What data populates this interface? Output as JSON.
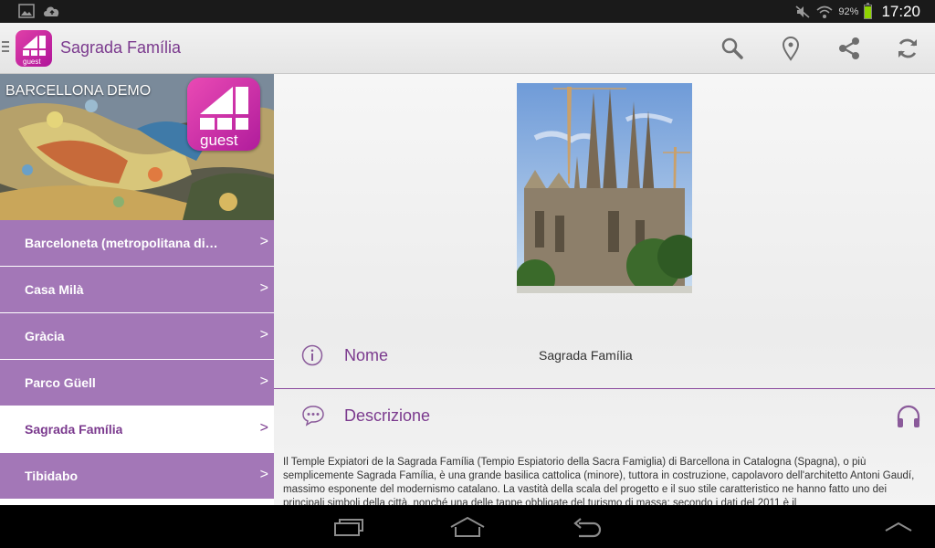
{
  "status_bar": {
    "battery": "92%",
    "time": "17:20",
    "icons": [
      "gallery-icon",
      "cloud-upload-icon",
      "mute-icon",
      "wifi-icon",
      "battery-icon"
    ]
  },
  "action_bar": {
    "title": "Sagrada Família",
    "logo_text": "guest",
    "actions": [
      "search-icon",
      "location-pin-icon",
      "share-icon",
      "refresh-icon"
    ]
  },
  "sidebar": {
    "hero_label": "BARCELLONA DEMO",
    "logo_text": "guest",
    "items": [
      {
        "label": "Barceloneta (metropolitana di…",
        "chevron": ">"
      },
      {
        "label": "Casa Milà",
        "chevron": ">"
      },
      {
        "label": "Gràcia",
        "chevron": ">"
      },
      {
        "label": "Parco Güell",
        "chevron": ">"
      },
      {
        "label": "Sagrada Família",
        "chevron": ">",
        "active": true
      },
      {
        "label": "Tibidabo",
        "chevron": ">"
      }
    ]
  },
  "detail": {
    "name_label": "Nome",
    "name_value": "Sagrada Família",
    "description_label": "Descrizione",
    "description_text": "Il Temple Expiatori de la Sagrada Família (Tempio Espiatorio della Sacra Famiglia) di Barcellona in Catalogna (Spagna), o più semplicemente Sagrada Família, è una grande basilica cattolica (minore), tuttora in costruzione, capolavoro dell'architetto Antoni Gaudí, massimo esponente del modernismo catalano. La vastità della scala del progetto e il suo stile caratteristico ne hanno fatto uno dei principali simboli della città, nonché una delle tappe obbligate del turismo di massa; secondo i dati del 2011 è il"
  },
  "colors": {
    "accent": "#7b3a8e",
    "menu_bg": "#a377b7",
    "logo_pink": "#e040a8"
  },
  "nav_bar": [
    "recent-apps-icon",
    "home-icon",
    "back-icon",
    "chevron-up-icon"
  ]
}
